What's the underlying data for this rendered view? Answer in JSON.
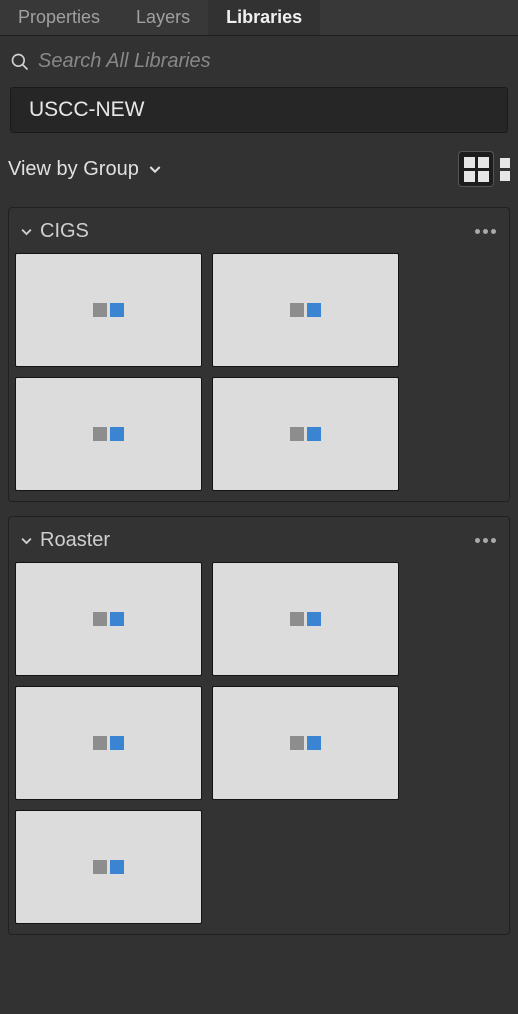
{
  "tabs": {
    "properties": "Properties",
    "layers": "Layers",
    "libraries": "Libraries",
    "active": "libraries"
  },
  "search": {
    "placeholder": "Search All Libraries",
    "value": ""
  },
  "library_selector": {
    "selected": "USCC-NEW"
  },
  "view": {
    "label": "View by Group",
    "mode": "grid"
  },
  "groups": [
    {
      "name": "CIGS",
      "item_count": 4
    },
    {
      "name": "Roaster",
      "item_count": 5
    }
  ],
  "colors": {
    "thumb_bg": "#dcdcdc",
    "swatch_gray": "#8d8d8d",
    "swatch_blue": "#3a84d2"
  }
}
